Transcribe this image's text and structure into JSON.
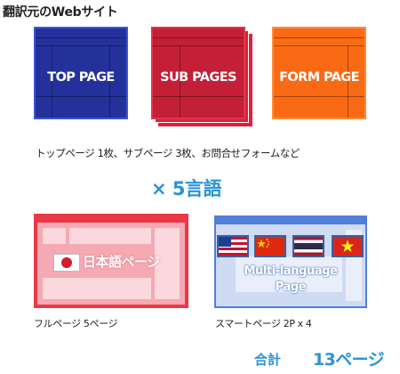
{
  "title": "翻訳元のWebサイト",
  "pages": [
    {
      "label": "TOP PAGE",
      "color": "#24319b"
    },
    {
      "label": "SUB PAGES",
      "color": "#c31f37"
    },
    {
      "label": "FORM PAGE",
      "color": "#fa6a14"
    }
  ],
  "caption_pages": "トップページ 1枚、サブページ 3枚、お問合せフォームなど",
  "multiplier": "× 5言語",
  "full_page": {
    "label": "日本語ページ",
    "flag": "japan-flag",
    "caption": "フルページ 5ページ"
  },
  "smart_page": {
    "label_line1": "Multi-language",
    "label_line2": "Page",
    "flags": [
      "usa-flag",
      "china-flag",
      "thailand-flag",
      "vietnam-flag"
    ],
    "caption": "スマートページ 2P x 4"
  },
  "total": {
    "label": "合計",
    "value": "13ページ"
  },
  "colors": {
    "accent": "#2a93d5",
    "full_page": "#ea3847",
    "smart_page": "#4f7fd6"
  }
}
